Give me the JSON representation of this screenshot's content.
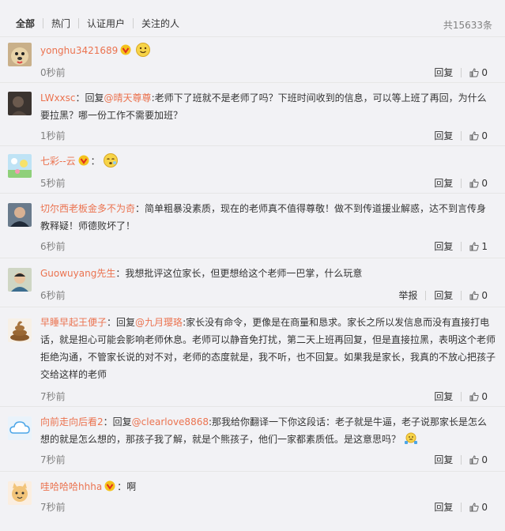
{
  "tabs": [
    {
      "label": "全部",
      "active": true
    },
    {
      "label": "热门",
      "active": false
    },
    {
      "label": "认证用户",
      "active": false
    },
    {
      "label": "关注的人",
      "active": false
    }
  ],
  "total": "共15633条",
  "actions": {
    "reply": "回复",
    "report": "举报"
  },
  "comments": [
    {
      "user": "yonghu3421689",
      "colon": "",
      "text": "",
      "emoji": "smile-emoji",
      "time": "0秒前",
      "likes": "0",
      "avatar": "dog-avatar"
    },
    {
      "user": "LWxxsc",
      "colon": "：",
      "prefix": "回复",
      "mention": "@晴天尊尊",
      "text": ":老师下了班就不是老师了吗？下班时间收到的信息，可以等上班了再回，为什么要拉黑？哪一份工作不需要加班？",
      "time": "1秒前",
      "likes": "0",
      "avatar": "dark-avatar"
    },
    {
      "user": "七彩--云",
      "colon": "：",
      "text": "",
      "emoji": "sleepy-emoji",
      "time": "5秒前",
      "likes": "0",
      "avatar": "cartoon-avatar"
    },
    {
      "user": "切尔西老板金多不为奇",
      "colon": "：",
      "text": "简单粗暴没素质，现在的老师真不值得尊敬！做不到传道援业解惑，达不到言传身教释疑！师德败坏了！",
      "time": "6秒前",
      "likes": "1",
      "avatar": "man-avatar"
    },
    {
      "user": "Guowuyang先生",
      "colon": "：",
      "text": "我想批评这位家长，但更想给这个老师一巴掌，什么玩意",
      "time": "6秒前",
      "likes": "0",
      "avatar": "kid-avatar",
      "report": true
    },
    {
      "user": "早睡早起王便子",
      "colon": "：",
      "prefix": "回复",
      "mention": "@九月璎珞",
      "text": ":家长没有命令，更像是在商量和恳求。家长之所以发信息而没有直接打电话，就是担心可能会影响老师休息。老师可以静音免打扰，第二天上班再回复，但是直接拉黑，表明这个老师拒绝沟通，不管家长说的对不对，老师的态度就是，我不听，也不回复。如果我是家长，我真的不放心把孩子交给这样的老师",
      "time": "7秒前",
      "likes": "0",
      "avatar": "poop-avatar"
    },
    {
      "user": "向前走向后看2",
      "colon": "：",
      "prefix": "回复",
      "mention": "@clearlove8868",
      "text": ":那我给你翻译一下你这段话：老子就是牛逼，老子说那家长是怎么想的就是怎么想的，那孩子我了解，就是个熊孩子，他们一家都素质低。是这意思吗？",
      "emoji": "shrug-emoji",
      "time": "7秒前",
      "likes": "0",
      "avatar": "cloud-avatar"
    },
    {
      "user": "哇哈哈哈hhha",
      "colon": "：",
      "text": "啊",
      "time": "7秒前",
      "likes": "0",
      "avatar": "pet-avatar"
    }
  ],
  "colors": {
    "accent": "#eb7350",
    "muted": "#808080",
    "bg": "#f2f2f5"
  }
}
